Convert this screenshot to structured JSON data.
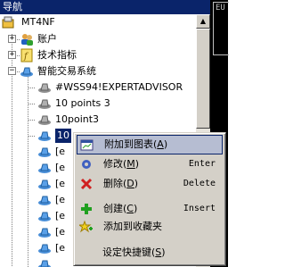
{
  "window": {
    "title": "导航"
  },
  "right_panel": {
    "text": "EU"
  },
  "tree": {
    "root": "MT4NF",
    "account": "账户",
    "indicators": "技术指标",
    "experts": "智能交易系统",
    "expert_items": [
      "#WSS94!EXPERTADVISOR",
      "10 points 3",
      "10point3",
      "10"
    ],
    "more_prefix": "[e"
  },
  "context_menu": {
    "items": [
      {
        "label": "附加到图表",
        "key": "A",
        "shortcut": ""
      },
      {
        "label": "修改",
        "key": "M",
        "shortcut": "Enter"
      },
      {
        "label": "删除",
        "key": "D",
        "shortcut": "Delete"
      },
      {
        "label": "创建",
        "key": "C",
        "shortcut": "Insert"
      },
      {
        "label": "添加到收藏夹",
        "key": "",
        "shortcut": ""
      },
      {
        "label": "设定快捷键",
        "key": "S",
        "shortcut": ""
      }
    ]
  },
  "colors": {
    "selection": "#0a246a",
    "menu_highlight": "#b6bdd2",
    "menu_bg": "#d4d0c8"
  }
}
